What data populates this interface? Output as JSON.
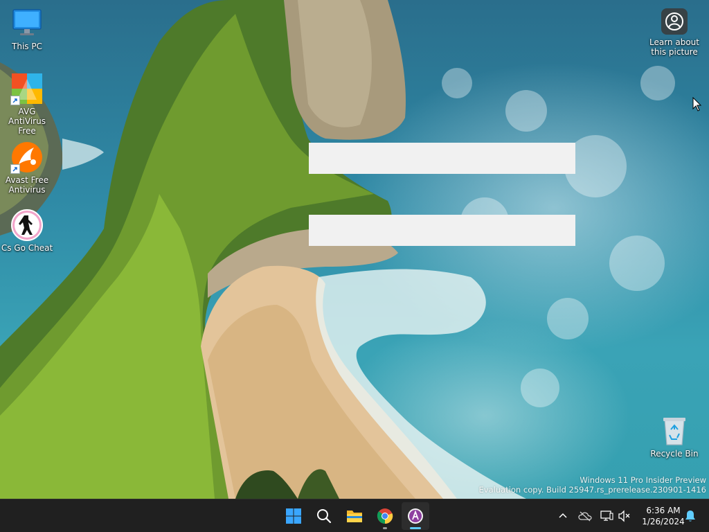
{
  "desktop": {
    "icons": [
      {
        "label": "This PC"
      },
      {
        "label": "AVG AntiVirus Free"
      },
      {
        "label": "Avast Free Antivirus"
      },
      {
        "label": "Cs Go Cheat"
      },
      {
        "label": "Recycle Bin"
      }
    ],
    "learn_picture": {
      "label": "Learn about this picture"
    },
    "watermark": {
      "line1": "Windows 11 Pro Insider Preview",
      "line2": "Evaluation copy. Build 25947.rs_prerelease.230901-1416"
    }
  },
  "taskbar": {
    "apps": [
      {
        "name": "Start",
        "icon": "windows-logo-icon"
      },
      {
        "name": "Search",
        "icon": "search-icon"
      },
      {
        "name": "File Explorer",
        "icon": "folder-icon"
      },
      {
        "name": "Google Chrome",
        "icon": "chrome-icon"
      },
      {
        "name": "Active App",
        "icon": "app-icon"
      }
    ],
    "tray": {
      "time": "6:36 AM",
      "date": "1/26/2024"
    }
  },
  "colors": {
    "taskbar_bg": "#202020",
    "accent": "#60cdff",
    "placeholder_bar": "#f1f1f1"
  }
}
